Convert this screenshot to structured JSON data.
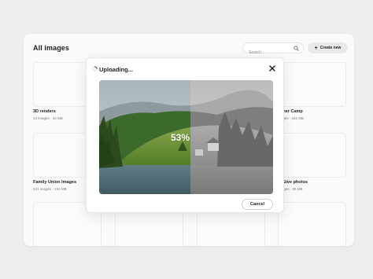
{
  "page": {
    "title": "All images"
  },
  "search": {
    "placeholder": "Search"
  },
  "create_button": {
    "label": "Create new"
  },
  "folders": [
    {
      "name": "3D renders",
      "meta": "12 images · 34 MB"
    },
    {
      "name": "mmer Camp",
      "meta": "mages · 342 MB"
    },
    {
      "name": "Family Union Images",
      "meta": "231 images · 194 MB"
    },
    {
      "name": "e2Give photos",
      "meta": "images · 86 MB"
    }
  ],
  "modal": {
    "title": "Uploading...",
    "progress_percent": 53,
    "progress_label": "53%",
    "cancel_label": "Cancel"
  }
}
